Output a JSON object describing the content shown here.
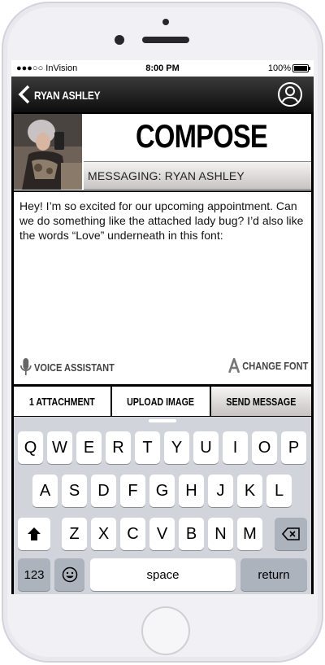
{
  "status_bar": {
    "carrier": "●●●○○ InVision",
    "time": "8:00 PM",
    "battery": "100%"
  },
  "nav": {
    "name": "RYAN ASHLEY"
  },
  "header": {
    "title": "COMPOSE",
    "messaging_label": "MESSAGING: RYAN ASHLEY"
  },
  "message": {
    "text": "Hey! I’m so excited for our upcoming appointment. Can we do something like the attached lady bug? I’d also like the words “Love” underneath in this font:"
  },
  "tools": {
    "voice": "VOICE ASSISTANT",
    "font": "CHANGE FONT"
  },
  "actions": {
    "attachment": "1 ATTACHMENT",
    "upload": "UPLOAD IMAGE",
    "send": "SEND MESSAGE"
  },
  "keyboard": {
    "row1": [
      "Q",
      "W",
      "E",
      "R",
      "T",
      "Y",
      "U",
      "I",
      "O",
      "P"
    ],
    "row2": [
      "A",
      "S",
      "D",
      "F",
      "G",
      "H",
      "J",
      "K",
      "L"
    ],
    "row3": [
      "Z",
      "X",
      "C",
      "V",
      "B",
      "N",
      "M"
    ],
    "numbers": "123",
    "space": "space",
    "return": "return"
  }
}
